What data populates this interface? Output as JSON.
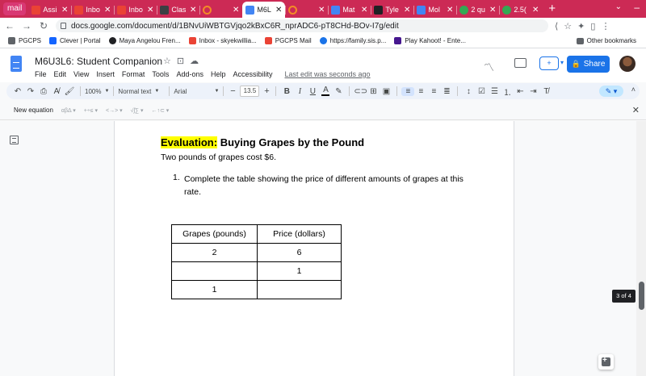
{
  "browser": {
    "tabs": [
      {
        "title": "mail",
        "first": true
      },
      {
        "title": "Assi",
        "favicon_color": "#ea4335"
      },
      {
        "title": "Inbo",
        "favicon_color": "#ea4335"
      },
      {
        "title": "Inbo",
        "favicon_color": "#ea4335"
      },
      {
        "title": "Clas",
        "favicon_color": "#3c4043"
      },
      {
        "title": "",
        "favicon_color": "#f28b26"
      },
      {
        "title": "M6L",
        "favicon_color": "#4285f4",
        "active": true
      },
      {
        "title": "",
        "favicon_color": "#f28b26"
      },
      {
        "title": "Mat",
        "favicon_color": "#4285f4"
      },
      {
        "title": "Tyle",
        "favicon_color": "#202124"
      },
      {
        "title": "Mol",
        "favicon_color": "#4285f4"
      },
      {
        "title": "2 qu",
        "favicon_color": "#34a853"
      },
      {
        "title": "2.5(",
        "favicon_color": "#34a853"
      }
    ],
    "new_tab": "+",
    "url": "docs.google.com/document/d/1BNvUiWBTGVjqo2kBxC6R_nprADC6-pT8CHd-BOv-I7g/edit",
    "bookmarks": [
      {
        "label": "PGCPS",
        "favicon_color": "#5f6368"
      },
      {
        "label": "Clever | Portal",
        "favicon_color": "#1464ff"
      },
      {
        "label": "Maya Angelou Fren...",
        "favicon_color": "#202124"
      },
      {
        "label": "Inbox - skyekwillia...",
        "favicon_color": "#ea4335"
      },
      {
        "label": "PGCPS Mail",
        "favicon_color": "#ea4335"
      },
      {
        "label": "https://family.sis.p...",
        "favicon_color": "#1a73e8"
      },
      {
        "label": "Play Kahoot! - Ente...",
        "favicon_color": "#46178f"
      }
    ],
    "other_bookmarks": "Other bookmarks"
  },
  "docs": {
    "title": "M6U3L6: Student Companion",
    "menu": [
      "File",
      "Edit",
      "View",
      "Insert",
      "Format",
      "Tools",
      "Add-ons",
      "Help",
      "Accessibility"
    ],
    "last_edit": "Last edit was seconds ago",
    "share_label": "Share",
    "toolbar": {
      "zoom": "100%",
      "style": "Normal text",
      "font": "Arial",
      "font_size": "13.5"
    },
    "equation_label": "New equation",
    "equation_groups": [
      "αβΔ ▾",
      "+÷≤ ▾",
      "<→> ▾",
      "√ʃ∑ ▾",
      "←↑⊂ ▾"
    ],
    "page_indicator": "3 of 4"
  },
  "document": {
    "heading_highlight": "Evaluation:",
    "heading_rest": " Buying Grapes by the Pound",
    "intro": "Two pounds of grapes cost $6.",
    "question_number": "1.",
    "question_text": "Complete the table showing the price of different amounts of grapes at this rate.",
    "table": {
      "headers": [
        "Grapes (pounds)",
        "Price (dollars)"
      ],
      "rows": [
        [
          "2",
          "6"
        ],
        [
          "",
          "1"
        ],
        [
          "1",
          ""
        ]
      ]
    }
  },
  "colors": {
    "tab_strip": "#cc2a55",
    "accent": "#1a73e8",
    "highlight": "#ffff00"
  }
}
